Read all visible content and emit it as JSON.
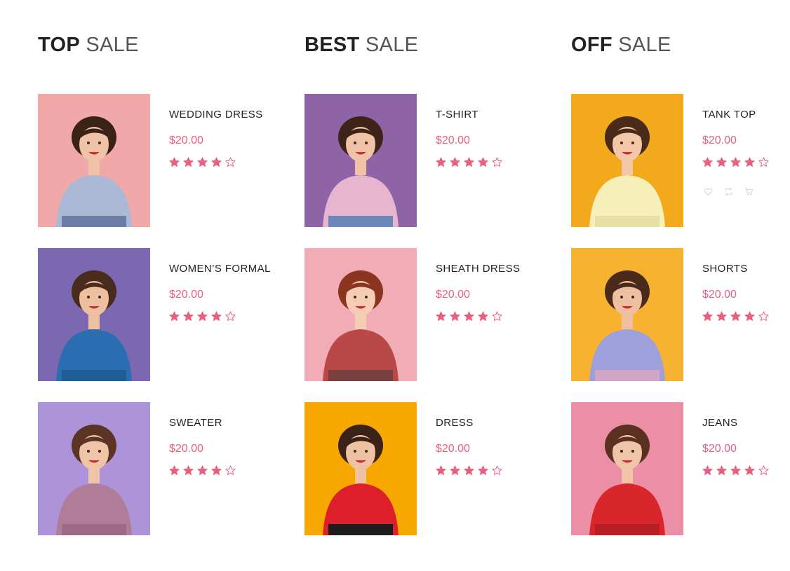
{
  "sections": [
    {
      "title_strong": "TOP",
      "title_light": "SALE",
      "products": [
        {
          "name": "WEDDING DRESS",
          "price": "$20.00",
          "rating": 4,
          "bg": "#f1a8a8",
          "skin": "#f0c2a6",
          "hair": "#3b2216",
          "top": "#a9b9d6",
          "bottom": "#6c7ea6"
        },
        {
          "name": "WOMEN’S FORMAL",
          "price": "$20.00",
          "rating": 4,
          "bg": "#7b68b0",
          "skin": "#eec0a0",
          "hair": "#4a2c1e",
          "top": "#2a6db0",
          "bottom": "#1f5d94"
        },
        {
          "name": "SWEATER",
          "price": "$20.00",
          "rating": 4,
          "bg": "#ad94d8",
          "skin": "#f0c4a6",
          "hair": "#5b3423",
          "top": "#b07c98",
          "bottom": "#9a6a86"
        }
      ]
    },
    {
      "title_strong": "BEST",
      "title_light": "SALE",
      "products": [
        {
          "name": "T-SHIRT",
          "price": "$20.00",
          "rating": 4,
          "bg": "#8e64a6",
          "skin": "#f0c2a8",
          "hair": "#3e2418",
          "top": "#e7b6ce",
          "bottom": "#6b88b8"
        },
        {
          "name": "SHEATH DRESS",
          "price": "$20.00",
          "rating": 4,
          "bg": "#f2acb6",
          "skin": "#f4cdb4",
          "hair": "#8b3420",
          "top": "#b94848",
          "bottom": "#7a4040"
        },
        {
          "name": "DRESS",
          "price": "$20.00",
          "rating": 4,
          "bg": "#f6a800",
          "skin": "#f0c2a4",
          "hair": "#3a2216",
          "top": "#dc1f2a",
          "bottom": "#1d1d1d"
        }
      ]
    },
    {
      "title_strong": "OFF",
      "title_light": "SALE",
      "products": [
        {
          "name": "TANK TOP",
          "price": "$20.00",
          "rating": 4,
          "bg": "#f2a91c",
          "skin": "#f2c6a6",
          "hair": "#4a2a1a",
          "top": "#f6f0b8",
          "bottom": "#e8dfa6",
          "actions": [
            "heart-icon",
            "compare-icon",
            "cart-icon"
          ]
        },
        {
          "name": "SHORTS",
          "price": "$20.00",
          "rating": 4,
          "bg": "#f8b232",
          "skin": "#eec0a0",
          "hair": "#4a2a1a",
          "top": "#9ea0dc",
          "bottom": "#d2a6c6"
        },
        {
          "name": "JEANS",
          "price": "$20.00",
          "rating": 4,
          "bg": "#ec8ea6",
          "skin": "#f0c4a6",
          "hair": "#5a3020",
          "top": "#d8262a",
          "bottom": "#b81f24"
        }
      ]
    }
  ],
  "colors": {
    "accent": "#e8607e",
    "heading_strong": "#222222",
    "heading_light": "#555555",
    "icon_muted": "#cfcfcf"
  }
}
